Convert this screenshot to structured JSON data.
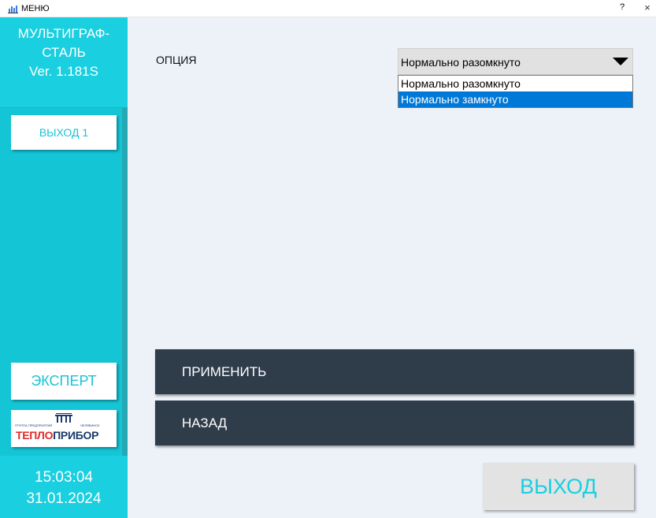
{
  "window": {
    "title": "МЕНЮ",
    "help_label": "?",
    "close_label": "×"
  },
  "sidebar": {
    "header_line1": "МУЛЬТИГРАФ-",
    "header_line2": "СТАЛЬ",
    "header_line3": "Ver. 1.181S",
    "output_button": "ВЫХОД 1",
    "expert_button": "ЭКСПЕРТ",
    "logo": {
      "small_left": "ГРУППА ПРЕДПРИЯТИЙ",
      "small_right": "ЧЕЛЯБИНСК",
      "main_red": "ТЕПЛО",
      "main_blue": "ПРИБОР"
    },
    "time": "15:03:04",
    "date": "31.01.2024"
  },
  "main": {
    "option_label": "ОПЦИЯ",
    "select": {
      "value": "Нормально разомкнуто",
      "options": [
        "Нормально разомкнуто",
        "Нормально замкнуто"
      ],
      "highlighted_index": 1
    },
    "apply_button": "ПРИМЕНИТЬ",
    "back_button": "НАЗАД",
    "exit_button": "ВЫХОД"
  },
  "colors": {
    "accent": "#19cfe0",
    "dark_button": "#2f3d4b",
    "highlight": "#0078d7",
    "background": "#edf2f9"
  }
}
